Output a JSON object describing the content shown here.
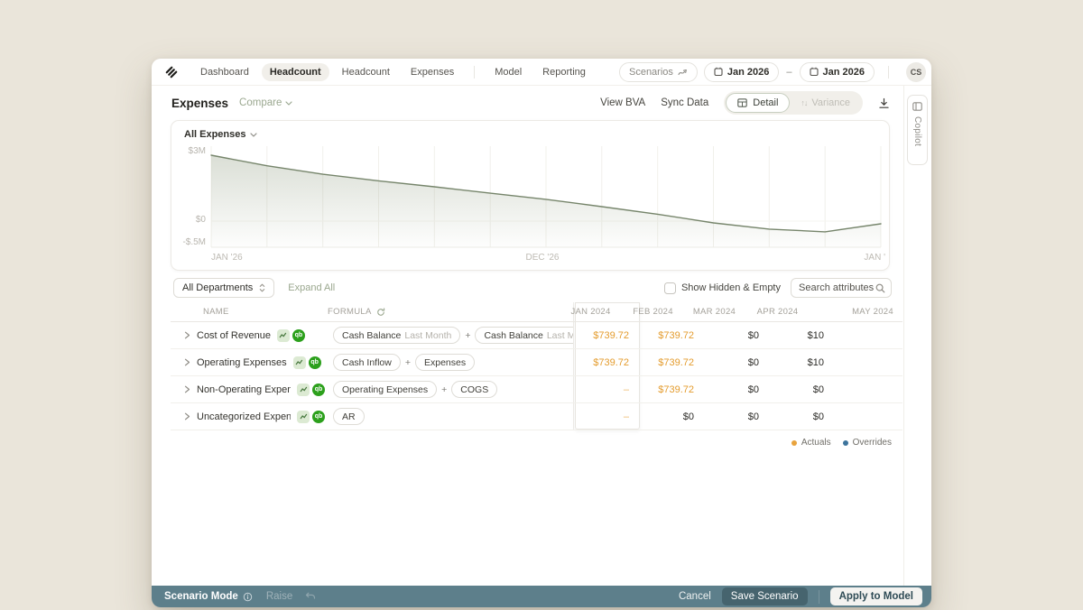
{
  "nav": {
    "tabs": [
      {
        "label": "Dashboard"
      },
      {
        "label": "Headcount",
        "active": true
      },
      {
        "label": "Headcount"
      },
      {
        "label": "Expenses"
      },
      {
        "label": "Model"
      },
      {
        "label": "Reporting"
      }
    ],
    "scenarios_label": "Scenarios",
    "date_from": "Jan 2026",
    "range_separator": "–",
    "date_to": "Jan 2026",
    "avatar_initials": "CS"
  },
  "header": {
    "title": "Expenses",
    "compare_label": "Compare",
    "view_bva": "View BVA",
    "sync_data": "Sync Data",
    "detail_label": "Detail",
    "variance_label": "Variance",
    "variance_arrows": "↑↓"
  },
  "copilot": {
    "label": "Copilot"
  },
  "chart_data": {
    "type": "area",
    "title": "All Expenses",
    "series": [
      {
        "name": "All Expenses",
        "values_musd": [
          2.88,
          2.42,
          2.05,
          1.76,
          1.5,
          1.22,
          0.95,
          0.63,
          0.3,
          -0.08,
          -0.35,
          -0.47,
          -0.12
        ]
      }
    ],
    "y_ticks": [
      "$3M",
      "$0",
      "-$.5M"
    ],
    "y_range_musd": [
      -0.5,
      3
    ],
    "x_labels": [
      "JAN '26",
      "DEC '26",
      "JAN '"
    ],
    "grid": "vertical",
    "line_color": "#76856B",
    "fill_color": "#9FAA92",
    "legend_position": "none"
  },
  "table": {
    "controls": {
      "departments": "All Departments",
      "expand_all": "Expand All",
      "show_hidden": "Show Hidden & Empty",
      "search_placeholder": "Search attributes"
    },
    "columns": {
      "name": "NAME",
      "formula": "FORMULA",
      "months": [
        "JAN 2024",
        "FEB 2024",
        "MAR 2024",
        "APR 2024",
        "MAY 2024"
      ]
    },
    "rows": [
      {
        "name": "Cost of Revenue",
        "formula": [
          {
            "kind": "pill",
            "text": "Cash Balance",
            "suffix": "Last Month"
          },
          {
            "kind": "op",
            "text": "+"
          },
          {
            "kind": "pill",
            "text": "Cash Balance",
            "suffix": "Last Month"
          }
        ],
        "values": [
          {
            "v": "$739.72",
            "style": "actual"
          },
          {
            "v": "$739.72",
            "style": "actual"
          },
          {
            "v": "$0",
            "style": "default"
          },
          {
            "v": "$10",
            "style": "default"
          }
        ]
      },
      {
        "name": "Operating Expenses",
        "formula": [
          {
            "kind": "pill",
            "text": "Cash Inflow"
          },
          {
            "kind": "op",
            "text": "+"
          },
          {
            "kind": "pill",
            "text": "Expenses"
          }
        ],
        "values": [
          {
            "v": "$739.72",
            "style": "actual"
          },
          {
            "v": "$739.72",
            "style": "actual"
          },
          {
            "v": "$0",
            "style": "default"
          },
          {
            "v": "$10",
            "style": "default"
          }
        ]
      },
      {
        "name": "Non-Operating Expenses",
        "formula": [
          {
            "kind": "pill",
            "text": "Operating Expenses"
          },
          {
            "kind": "op",
            "text": "+"
          },
          {
            "kind": "pill",
            "text": "COGS"
          }
        ],
        "values": [
          {
            "v": "–",
            "style": "dash"
          },
          {
            "v": "$739.72",
            "style": "actual"
          },
          {
            "v": "$0",
            "style": "default"
          },
          {
            "v": "$0",
            "style": "default"
          }
        ]
      },
      {
        "name": "Uncategorized Expenses",
        "formula": [
          {
            "kind": "pill",
            "text": "AR"
          }
        ],
        "values": [
          {
            "v": "–",
            "style": "dash"
          },
          {
            "v": "$0",
            "style": "default"
          },
          {
            "v": "$0",
            "style": "default"
          },
          {
            "v": "$0",
            "style": "default"
          }
        ]
      }
    ]
  },
  "legend": {
    "actuals": "Actuals",
    "overrides": "Overrides",
    "actuals_color": "#E8A33D",
    "overrides_color": "#3D749C"
  },
  "footer": {
    "mode_label": "Scenario Mode",
    "scenario_name": "Raise",
    "cancel": "Cancel",
    "save": "Save Scenario",
    "apply": "Apply to Model"
  }
}
